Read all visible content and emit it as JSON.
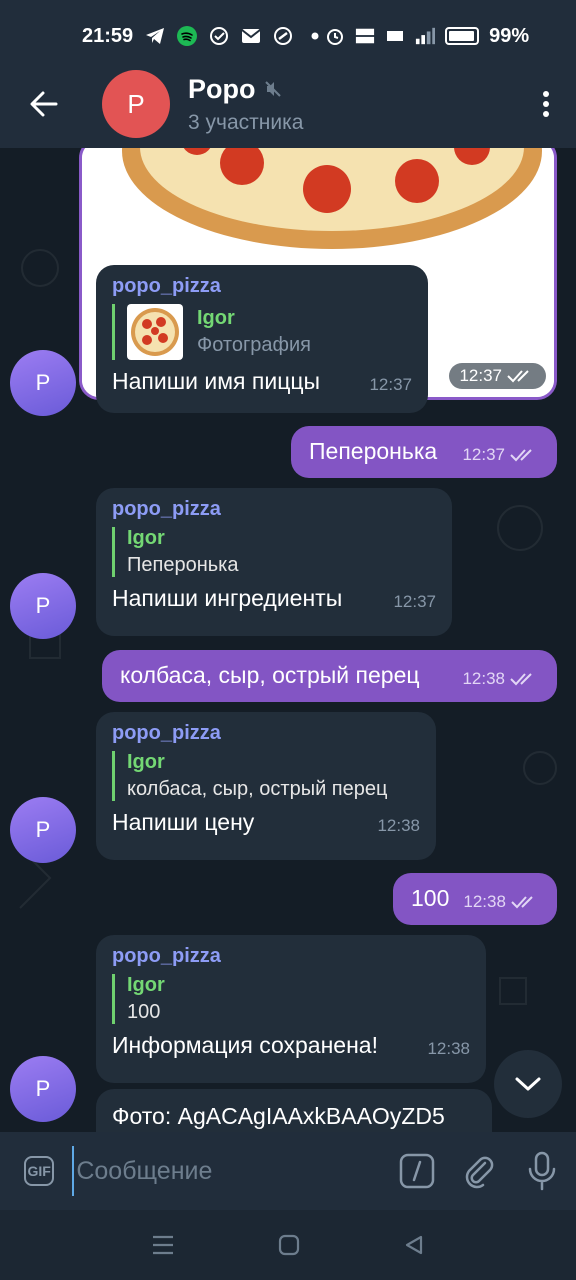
{
  "status_bar": {
    "time": "21:59",
    "battery": "99%",
    "icons": [
      "telegram-icon",
      "spotify-icon",
      "check-circle-icon",
      "mail-icon",
      "link-icon",
      "dot-icon",
      "alarm-icon",
      "volte-icon",
      "4g-icon",
      "signal-icon",
      "battery-icon"
    ]
  },
  "header": {
    "avatar_letter": "P",
    "title": "Popo",
    "subtitle": "3 участника",
    "avatar_color": "#e25454"
  },
  "messages": [
    {
      "type": "photo",
      "time": "12:37"
    },
    {
      "sender": "popo_pizza",
      "reply_name": "Igor",
      "reply_text": "Фотография",
      "text": "Напиши имя пиццы",
      "time": "12:37"
    },
    {
      "out": true,
      "text": "Пеперонька",
      "time": "12:37"
    },
    {
      "sender": "popo_pizza",
      "reply_name": "Igor",
      "reply_text": "Пеперонька",
      "text": "Напиши ингредиенты",
      "time": "12:37"
    },
    {
      "out": true,
      "text": "колбаса, сыр, острый перец",
      "time": "12:38"
    },
    {
      "sender": "popo_pizza",
      "reply_name": "Igor",
      "reply_text": "колбаса, сыр, острый перец",
      "text": "Напиши цену",
      "time": "12:38"
    },
    {
      "out": true,
      "text": "100",
      "time": "12:38"
    },
    {
      "sender": "popo_pizza",
      "reply_name": "Igor",
      "reply_text": "100",
      "text": "Информация сохранена!",
      "time": "12:38"
    },
    {
      "partial_text": "Фото: AgACAgIAAxkBAAOyZD5"
    }
  ],
  "avatar_letter": "P",
  "input": {
    "gif_label": "GIF",
    "placeholder": "Сообщение"
  },
  "colors": {
    "outgoing_bubble": "#8355c4",
    "incoming_bubble": "#222e3a",
    "sender_name": "#8d9cf5",
    "reply_name": "#74d874"
  }
}
